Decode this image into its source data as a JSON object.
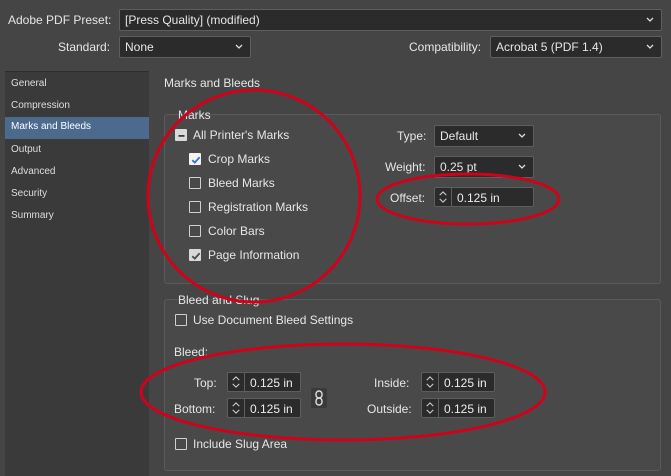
{
  "header": {
    "preset_label": "Adobe PDF Preset:",
    "preset_value": "[Press Quality] (modified)",
    "standard_label": "Standard:",
    "standard_value": "None",
    "compat_label": "Compatibility:",
    "compat_value": "Acrobat 5 (PDF 1.4)"
  },
  "sidebar": {
    "items": [
      {
        "label": "General"
      },
      {
        "label": "Compression"
      },
      {
        "label": "Marks and Bleeds",
        "active": true
      },
      {
        "label": "Output"
      },
      {
        "label": "Advanced"
      },
      {
        "label": "Security"
      },
      {
        "label": "Summary"
      }
    ]
  },
  "panel": {
    "title": "Marks and Bleeds"
  },
  "marks": {
    "group_title": "Marks",
    "all_printers": {
      "label": "All Printer's Marks",
      "state": "mixed"
    },
    "items": [
      {
        "label": "Crop Marks",
        "checked": true
      },
      {
        "label": "Bleed Marks",
        "checked": false
      },
      {
        "label": "Registration Marks",
        "checked": false
      },
      {
        "label": "Color Bars",
        "checked": false
      },
      {
        "label": "Page Information",
        "checked": true
      }
    ],
    "type_label": "Type:",
    "type_value": "Default",
    "weight_label": "Weight:",
    "weight_value": "0.25 pt",
    "offset_label": "Offset:",
    "offset_value": "0.125 in"
  },
  "bleed": {
    "group_title": "Bleed and Slug",
    "use_doc_label": "Use Document Bleed Settings",
    "bleed_label": "Bleed:",
    "top_label": "Top:",
    "top_value": "0.125 in",
    "bottom_label": "Bottom:",
    "bottom_value": "0.125 in",
    "inside_label": "Inside:",
    "inside_value": "0.125 in",
    "outside_label": "Outside:",
    "outside_value": "0.125 in",
    "slug_label": "Include Slug Area"
  },
  "colors": {
    "background": "#454545",
    "field": "#2b2b2b",
    "selection": "#4c6a8e",
    "annotation": "#d0021b"
  }
}
